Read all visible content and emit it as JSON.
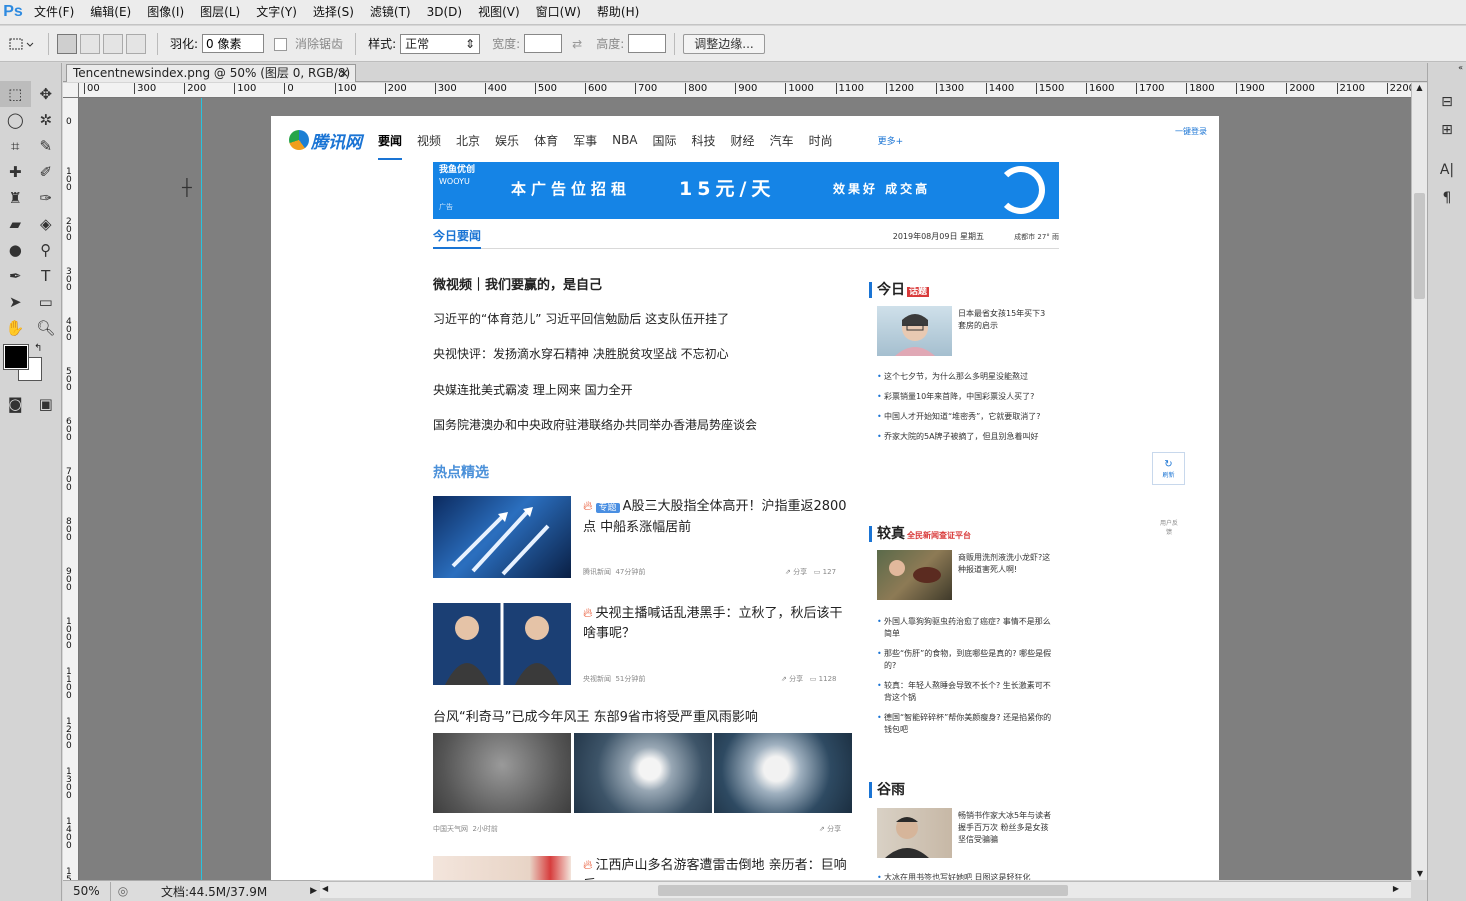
{
  "app": {
    "logo": "Ps"
  },
  "menu": [
    "文件(F)",
    "编辑(E)",
    "图像(I)",
    "图层(L)",
    "文字(Y)",
    "选择(S)",
    "滤镜(T)",
    "3D(D)",
    "视图(V)",
    "窗口(W)",
    "帮助(H)"
  ],
  "options": {
    "feather_label": "羽化:",
    "feather_value": "0 像素",
    "antialias_label": "消除锯齿",
    "style_label": "样式:",
    "style_value": "正常",
    "width_label": "宽度:",
    "height_label": "高度:",
    "refine_edge": "调整边缘..."
  },
  "document": {
    "tab_title": "Tencentnewsindex.png @ 50% (图层 0, RGB/8) *",
    "close": "×"
  },
  "ruler": {
    "h_labels": [
      "00",
      "300",
      "200",
      "100",
      "0",
      "100",
      "200",
      "300",
      "400",
      "500",
      "600",
      "700",
      "800",
      "900",
      "1000",
      "1100",
      "1200",
      "1300",
      "1400",
      "1500",
      "1600",
      "1700",
      "1800",
      "1900",
      "2000",
      "2100",
      "2200"
    ],
    "v_labels": [
      "0",
      "100",
      "200",
      "300",
      "400",
      "500",
      "600",
      "700",
      "800",
      "900",
      "1000",
      "1100",
      "1200",
      "1300",
      "1400",
      "1500"
    ]
  },
  "status": {
    "zoom": "50%",
    "doc": "文档:44.5M/37.9M"
  },
  "web": {
    "logo": "腾讯网",
    "nav": [
      "要闻",
      "视频",
      "北京",
      "娱乐",
      "体育",
      "军事",
      "NBA",
      "国际",
      "科技",
      "财经",
      "汽车",
      "时尚"
    ],
    "nav_more": "更多+",
    "login": "一键登录",
    "ad": {
      "brand": "我鱼优创",
      "brand_en": "WOOYU",
      "tag": "广告",
      "main": "本广告位招租",
      "price": "15元/天",
      "slogan": "效果好 成交高"
    },
    "section_today": "今日要闻",
    "date": "2019年08月09日 星期五",
    "weather": "成都市 27° 雨",
    "top_headline": "微视频｜我们要赢的，是自己",
    "headlines": [
      "习近平的“体育范儿” 习近平回信勉励后 这支队伍开挂了",
      "央视快评：发扬滴水穿石精神 决胜脱贫攻坚战 不忘初心",
      "央媒连批美式霸凌 理上网来 国力全开",
      "国务院港澳办和中央政府驻港联络办共同举办香港局势座谈会"
    ],
    "section_hot": "热点精选",
    "news": [
      {
        "tag": "专题",
        "title": "A股三大股指全体高开！沪指重返2800点 中船系涨幅居前",
        "source": "腾讯新闻",
        "time": "47分钟前",
        "share": "分享",
        "comments": "127"
      },
      {
        "title": "央视主播喊话乱港黑手：立秋了，秋后该干啥事呢？",
        "source": "央视新闻",
        "time": "51分钟前",
        "share": "分享",
        "comments": "1128"
      },
      {
        "title": "台风“利奇马”已成今年风王 东部9省市将受严重风雨影响",
        "source": "中国天气网",
        "time": "2小时前",
        "share": "分享"
      },
      {
        "title": "江西庐山多名游客遭雷击倒地 亲历者：巨响后"
      }
    ],
    "side": {
      "topic_head": "今日",
      "topic_badge": "话题",
      "topic_thumb_text": "日本最省女孩15年买下3套房的启示",
      "topic_list": [
        "这个七夕节，为什么那么多明星没能熬过",
        "彩票销量10年来首降，中国彩票没人买了?",
        "中国人才开始知道“堆密秀”，它就要取消了?",
        "乔家大院的5A牌子被摘了，但且别急着叫好"
      ],
      "verify_head": "较真",
      "verify_sub": "全民新闻查证平台",
      "verify_thumb_text": "商贩用洗剂液洗小龙虾?这种报道害死人啊!",
      "verify_list": [
        "外国人靠狗狗驱虫药治愈了癌症? 事情不是那么简单",
        "那些“伤肝”的食物，到底哪些是真的? 哪些是假的?",
        "较真：年轻人熬睡会导致不长个? 生长激素可不背这个锅",
        "德国“智能碎碎杯”帮你美颜瘦身? 还是掐紧你的钱包吧"
      ],
      "guyu_head": "谷雨",
      "guyu_thumb_text": "畅销书作家大冰5年与读者握手百万次 粉丝多是女孩坚信受骗骗",
      "guyu_list": [
        "大冰在用书签也写好她吧 日图这是轻狂化"
      ]
    },
    "refresh": "刷新",
    "feedback": "用户反馈"
  }
}
